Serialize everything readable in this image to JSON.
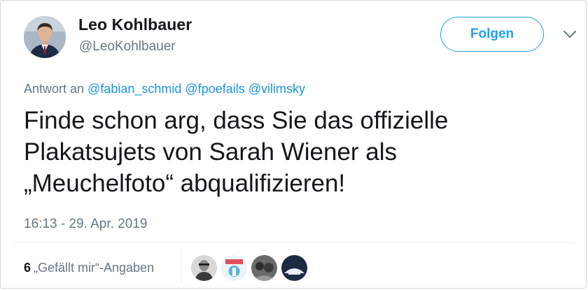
{
  "user": {
    "display_name": "Leo Kohlbauer",
    "handle": "@LeoKohlbauer"
  },
  "follow": {
    "label": "Folgen"
  },
  "reply": {
    "prefix": "Antwort an",
    "mentions": [
      "@fabian_schmid",
      "@fpoefails",
      "@vilimsky"
    ]
  },
  "text": {
    "line1": "Finde schon arg, dass Sie das offizielle",
    "line2": "Plakatsujets von Sarah Wiener als",
    "line3": "„Meuchelfoto“ abqualifizieren!"
  },
  "timestamp": "16:13 - 29. Apr. 2019",
  "likes": {
    "count": "6",
    "label": "„Gefällt mir“-Angaben"
  },
  "colors": {
    "accent": "#1da1f2",
    "mention": "#1b95e0",
    "secondary_text": "#657786"
  },
  "icons": {
    "caret": "chevron-down-icon"
  }
}
